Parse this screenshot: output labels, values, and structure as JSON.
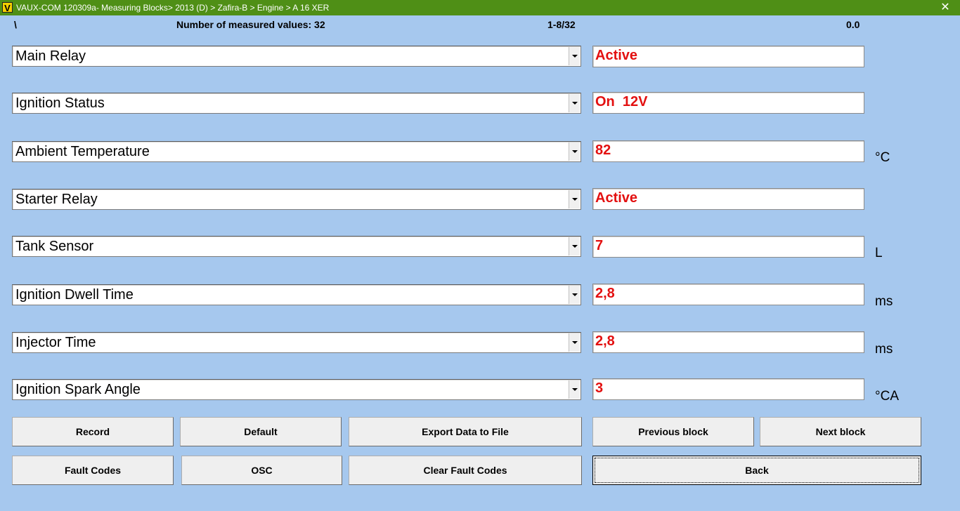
{
  "window": {
    "icon_letter": "V",
    "title": "VAUX-COM 120309a- Measuring Blocks> 2013 (D) > Zafira-B > Engine > A 16 XER",
    "close_glyph": "✕"
  },
  "header": {
    "indicator": "\\",
    "measured_count": "Number of measured values: 32",
    "page": "1-8/32",
    "value": "0.0"
  },
  "rows": [
    {
      "label": "Main Relay",
      "value": "Active",
      "unit": ""
    },
    {
      "label": "Ignition Status",
      "value": "On  12V",
      "unit": ""
    },
    {
      "label": "Ambient Temperature",
      "value": "82",
      "unit": "°C"
    },
    {
      "label": "Starter Relay",
      "value": "Active",
      "unit": ""
    },
    {
      "label": "Tank Sensor",
      "value": "7",
      "unit": "L"
    },
    {
      "label": "Ignition Dwell Time",
      "value": "2,8",
      "unit": "ms"
    },
    {
      "label": "Injector Time",
      "value": "2,8",
      "unit": "ms"
    },
    {
      "label": "Ignition Spark Angle",
      "value": "3",
      "unit": "°CA"
    }
  ],
  "buttons": {
    "record": "Record",
    "default": "Default",
    "export": "Export Data to File",
    "previous_block": "Previous block",
    "next_block": "Next block",
    "fault_codes": "Fault Codes",
    "osc": "OSC",
    "clear_fault_codes": "Clear Fault Codes",
    "back": "Back"
  },
  "colors": {
    "background": "#a6c8ee",
    "titlebar": "#4f8f16",
    "value_text": "#e31010"
  }
}
